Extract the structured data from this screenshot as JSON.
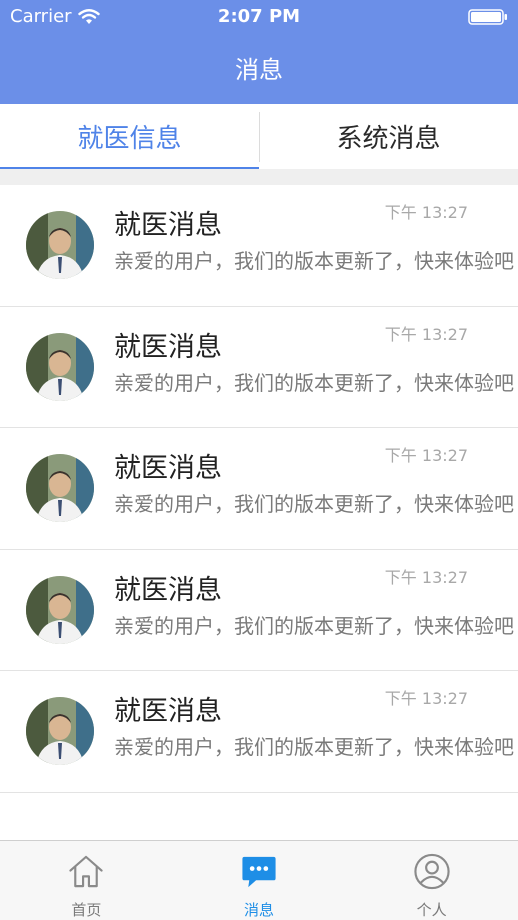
{
  "status_bar": {
    "carrier": "Carrier",
    "time": "2:07 PM"
  },
  "nav": {
    "title": "消息"
  },
  "tabs": [
    {
      "label": "就医信息",
      "active": true
    },
    {
      "label": "系统消息",
      "active": false
    }
  ],
  "messages": [
    {
      "title": "就医消息",
      "time": "下午 13:27",
      "preview": "亲爱的用户，我们的版本更新了，快来体验吧"
    },
    {
      "title": "就医消息",
      "time": "下午 13:27",
      "preview": "亲爱的用户，我们的版本更新了，快来体验吧"
    },
    {
      "title": "就医消息",
      "time": "下午 13:27",
      "preview": "亲爱的用户，我们的版本更新了，快来体验吧"
    },
    {
      "title": "就医消息",
      "time": "下午 13:27",
      "preview": "亲爱的用户，我们的版本更新了，快来体验吧"
    },
    {
      "title": "就医消息",
      "time": "下午 13:27",
      "preview": "亲爱的用户，我们的版本更新了，快来体验吧"
    }
  ],
  "tabbar": [
    {
      "label": "首页",
      "icon": "home-icon",
      "active": false
    },
    {
      "label": "消息",
      "icon": "chat-bubble-icon",
      "active": true
    },
    {
      "label": "个人",
      "icon": "person-icon",
      "active": false
    }
  ],
  "colors": {
    "header_bg": "#6b8fe8",
    "accent": "#4f83e8",
    "tabbar_active": "#1e8ee6"
  }
}
